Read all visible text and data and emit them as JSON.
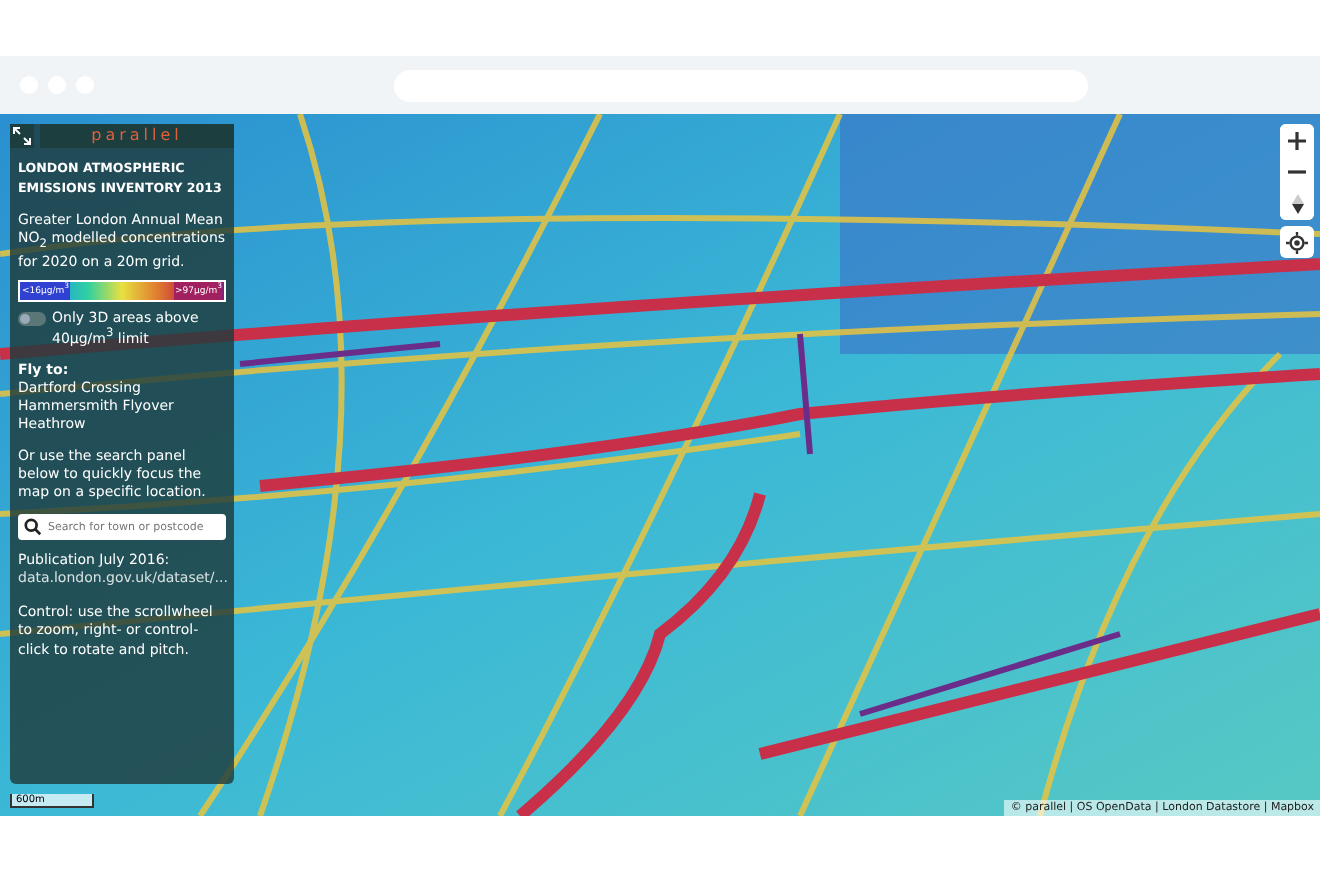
{
  "panel": {
    "logo": "parallel",
    "title": "LONDON ATMOSPHERIC EMISSIONS INVENTORY 2013",
    "description": "Greater London Annual Mean NO$_{2}$ modelled concentrations for 2020 on a 20m grid.",
    "legend": {
      "min": "<16μg/m$^{3}$",
      "max": ">97μg/m$^{3}$"
    },
    "toggle": {
      "label": "Only 3D areas above 40μg/m$^{3}$ limit",
      "on": false
    },
    "fly_heading": "Fly to:",
    "fly_links": [
      "Dartford Crossing",
      "Hammersmith Flyover",
      "Heathrow"
    ],
    "search_hint": "Or use the search panel below to quickly focus the map on a specific location.",
    "search": {
      "placeholder": "Search for town or postcode"
    },
    "publication": "Publication July 2016:",
    "publication_link": "data.london.gov.uk/dataset/...",
    "control_note": "Control: use the scrollwheel to zoom, right- or control-click to rotate and pitch."
  },
  "map": {
    "scale": "600m",
    "attribution": "© parallel | OS OpenData | London Datastore | Mapbox"
  }
}
